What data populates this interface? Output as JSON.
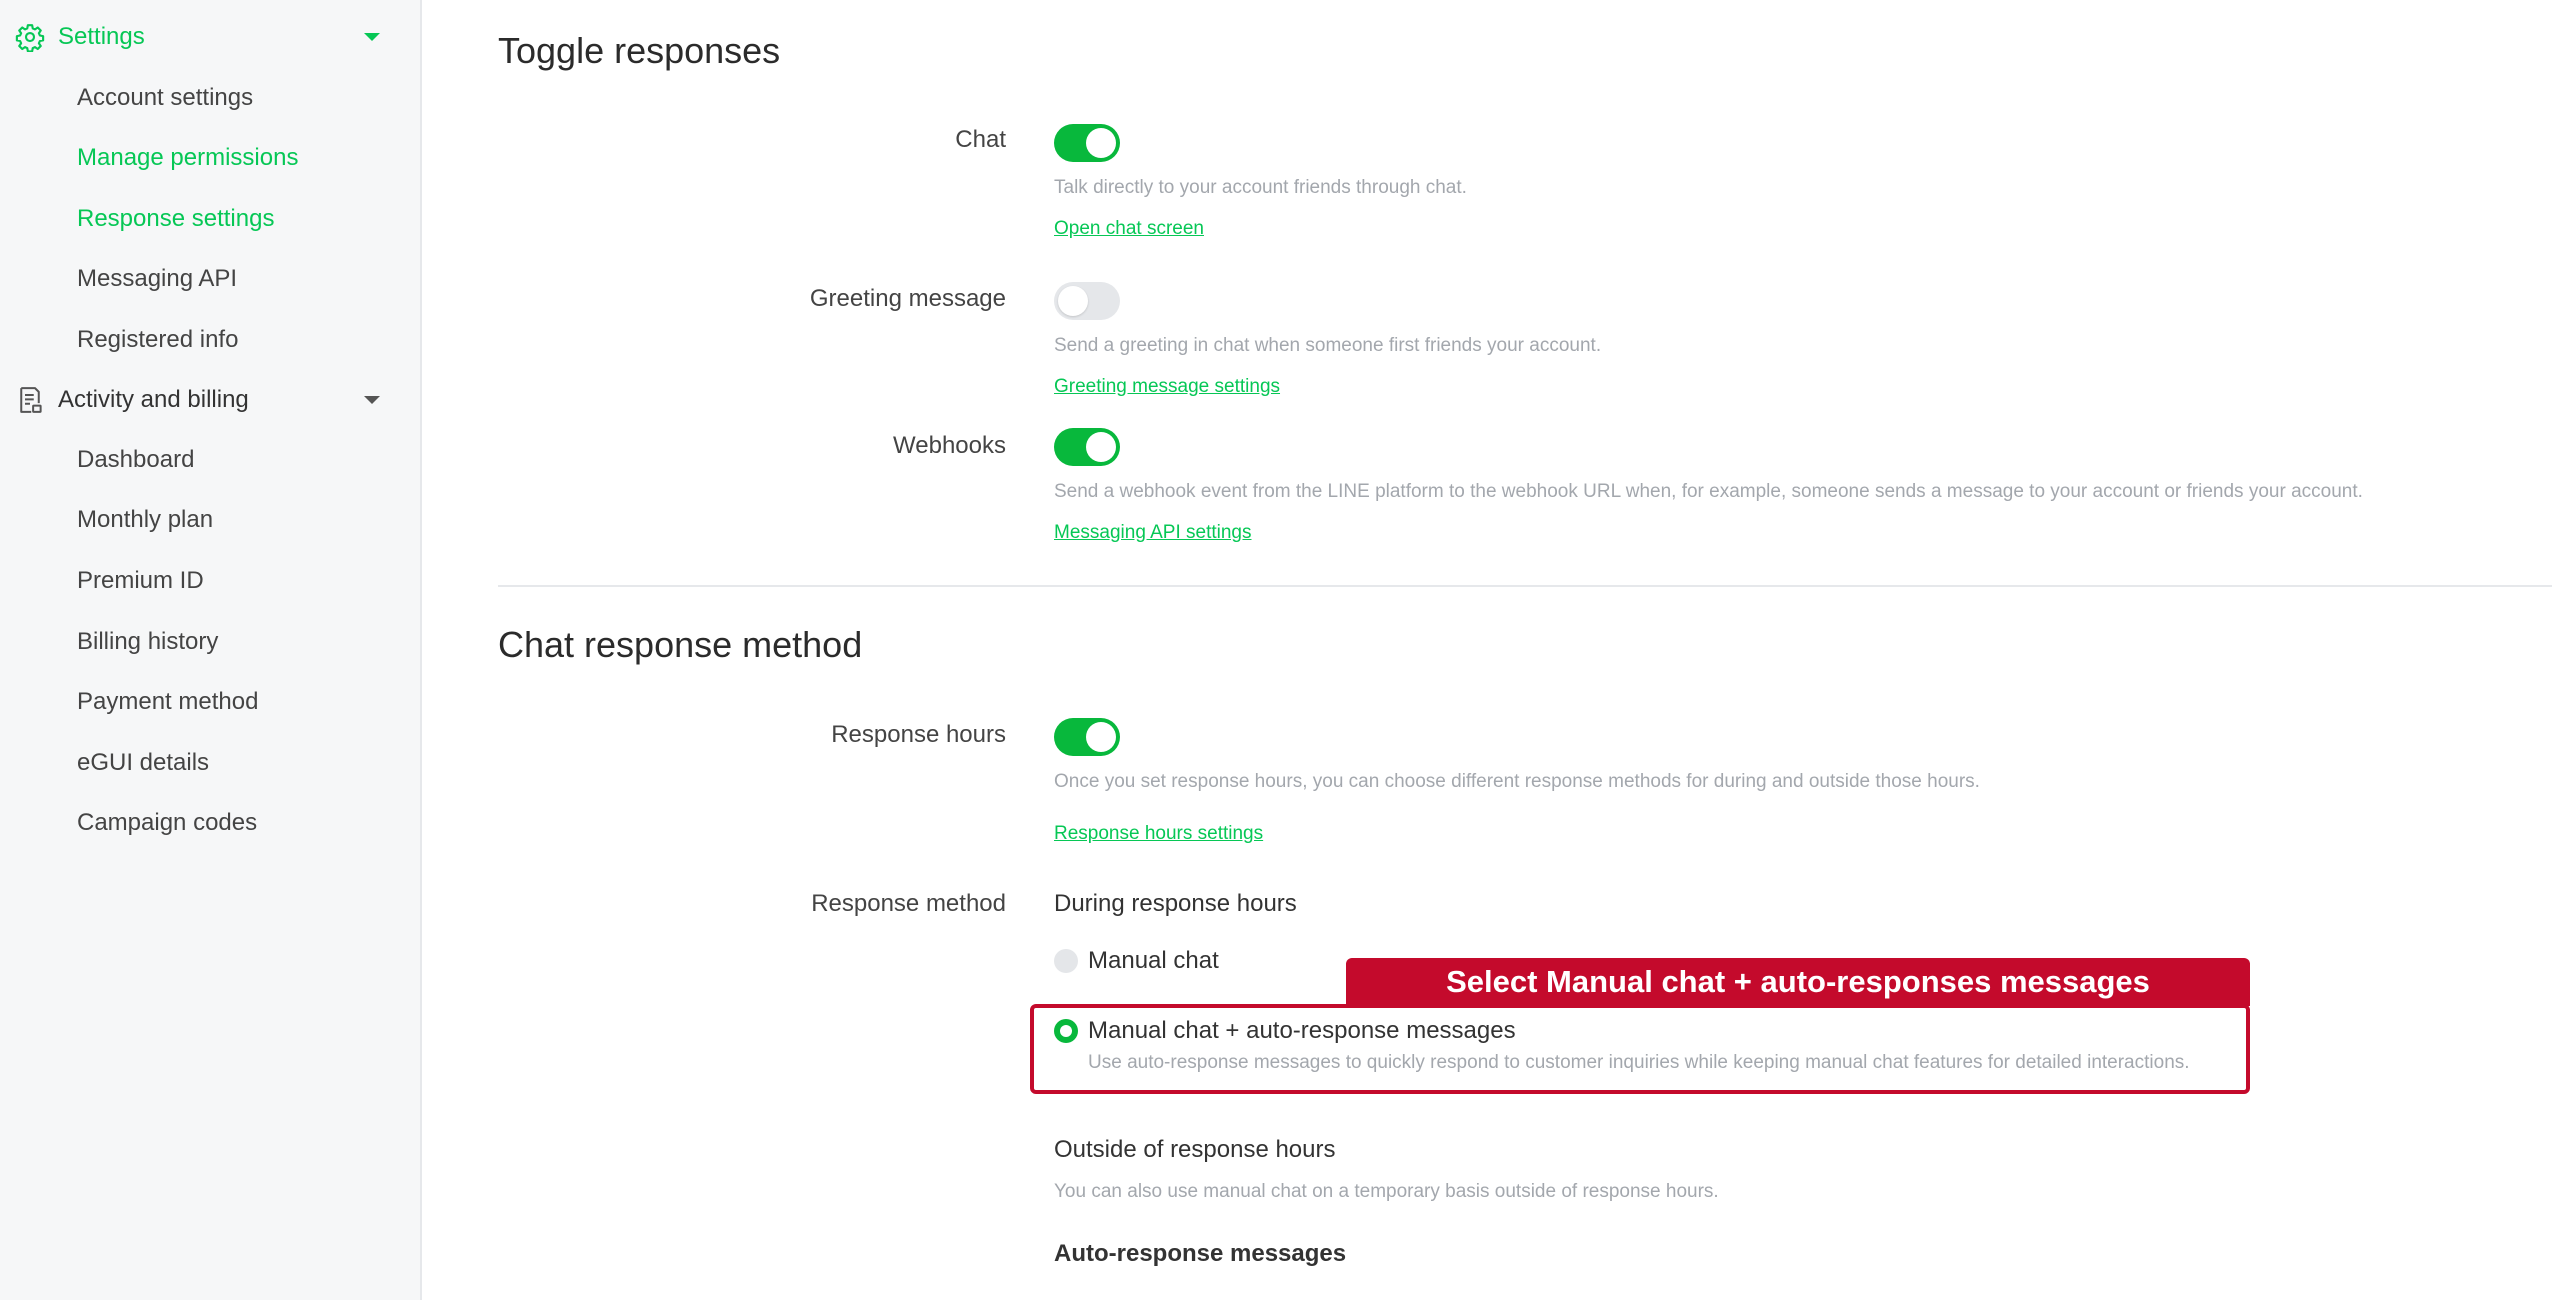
{
  "sidebar": {
    "settings": {
      "label": "Settings",
      "items": [
        "Account settings",
        "Manage permissions",
        "Response settings",
        "Messaging API",
        "Registered info"
      ]
    },
    "activity": {
      "label": "Activity and billing",
      "items": [
        "Dashboard",
        "Monthly plan",
        "Premium ID",
        "Billing history",
        "Payment method",
        "eGUI details",
        "Campaign codes"
      ]
    }
  },
  "toggle_section": {
    "title": "Toggle responses",
    "chat": {
      "label": "Chat",
      "enabled": true,
      "description": "Talk directly to your account friends through chat.",
      "link": "Open chat screen"
    },
    "greeting": {
      "label": "Greeting message",
      "enabled": false,
      "description": "Send a greeting in chat when someone first friends your account.",
      "link": "Greeting message settings"
    },
    "webhooks": {
      "label": "Webhooks",
      "enabled": true,
      "description": "Send a webhook event from the LINE platform to the webhook URL when, for example, someone sends a message to your account or friends your account.",
      "link": "Messaging API settings"
    }
  },
  "chat_section": {
    "title": "Chat response method",
    "response_hours": {
      "label": "Response hours",
      "enabled": true,
      "description": "Once you set response hours, you can choose different response methods for during and outside those hours.",
      "link": "Response hours settings"
    },
    "response_method": {
      "label": "Response method",
      "during_heading": "During response hours",
      "options": [
        {
          "label": "Manual chat",
          "selected": false
        },
        {
          "label": "Manual chat + auto-response messages",
          "selected": true,
          "description": "Use auto-response messages to quickly respond to customer inquiries while keeping manual chat features for detailed interactions."
        }
      ],
      "outside_heading": "Outside of response hours",
      "outside_description": "You can also use manual chat on a temporary basis outside of response hours.",
      "auto_response_heading": "Auto-response messages"
    }
  },
  "callout": {
    "text": "Select Manual chat + auto-responses messages",
    "color": "#c40a2c"
  },
  "colors": {
    "accent": "#06c755",
    "toggle_on": "#08b83c"
  }
}
